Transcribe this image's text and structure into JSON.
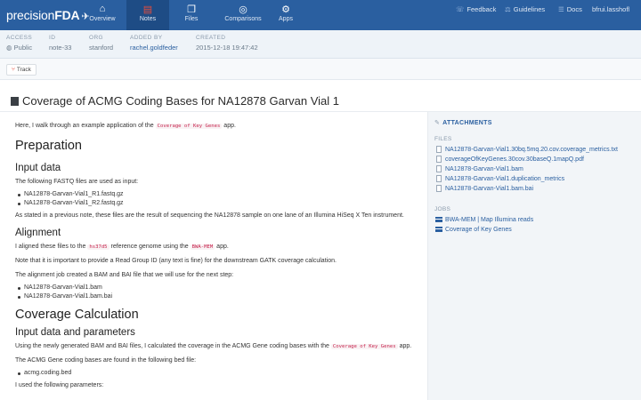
{
  "nav": {
    "brand_light": "precision",
    "brand_bold": "FDA",
    "tabs": [
      {
        "label": "Overview",
        "icon": "home-icon",
        "glyph": "⌂"
      },
      {
        "label": "Notes",
        "icon": "notes-icon",
        "glyph": "▤"
      },
      {
        "label": "Files",
        "icon": "files-icon",
        "glyph": "❐"
      },
      {
        "label": "Comparisons",
        "icon": "comparisons-icon",
        "glyph": "◎"
      },
      {
        "label": "Apps",
        "icon": "apps-icon",
        "glyph": "⚙"
      }
    ],
    "right": [
      {
        "label": "Feedback",
        "icon": "feedback-icon",
        "glyph": "☏"
      },
      {
        "label": "Guidelines",
        "icon": "guidelines-icon",
        "glyph": "⚖"
      },
      {
        "label": "Docs",
        "icon": "docs-icon",
        "glyph": "☰"
      },
      {
        "label": "bfrui.lasshofl",
        "icon": "user-icon",
        "glyph": ""
      }
    ]
  },
  "meta": {
    "access": {
      "label": "ACCESS",
      "value": "Public"
    },
    "id": {
      "label": "ID",
      "value": "note-33"
    },
    "org": {
      "label": "ORG",
      "value": "stanford"
    },
    "added_by": {
      "label": "ADDED BY",
      "value": "rachel.goldfeder"
    },
    "created": {
      "label": "CREATED",
      "value": "2015-12-18 19:47:42"
    }
  },
  "track_label": "Track",
  "title": "Coverage of ACMG Coding Bases for NA12878 Garvan Vial 1",
  "body": {
    "intro_pre": "Here, I walk through an example application of the",
    "intro_code": "Coverage of Key Genes",
    "intro_post": "app.",
    "h_preparation": "Preparation",
    "h_input_data": "Input data",
    "fastq_intro": "The following FASTQ files are used as input:",
    "fastq_files": [
      "NA12878-Garvan-Vial1_R1.fastq.gz",
      "NA12878-Garvan-Vial1_R2.fastq.gz"
    ],
    "fastq_note": "As stated in a previous note, these files are the result of sequencing the NA12878 sample on one lane of an Illumina HiSeq X Ten instrument.",
    "h_alignment": "Alignment",
    "align_pre": "I aligned these files to the",
    "align_code1": "hs37d5",
    "align_mid": "reference genome using the",
    "align_code2": "BWA-MEM",
    "align_post": "app.",
    "readgroup_note": "Note that it is important to provide a Read Group ID (any text is fine) for the downstream GATK coverage calculation.",
    "align_output_intro": "The alignment job created a BAM and BAI file that we will use for the next step:",
    "align_outputs": [
      "NA12878-Garvan-Vial1.bam",
      "NA12878-Garvan-Vial1.bam.bai"
    ],
    "h_coverage": "Coverage Calculation",
    "h_input_params": "Input data and parameters",
    "cov_pre": "Using the newly generated BAM and BAI files, I calculated the coverage in the ACMG Gene coding bases with the",
    "cov_code": "Coverage of Key Genes",
    "cov_post": "app.",
    "bed_intro": "The ACMG Gene coding bases are found in the following bed file:",
    "bed_files": [
      "acmg.coding.bed"
    ],
    "params_intro": "I used the following parameters:"
  },
  "attachments": {
    "heading": "ATTACHMENTS",
    "files_label": "FILES",
    "files": [
      "NA12878-Garvan-Vial1.30bq.5mq.20.cov.coverage_metrics.txt",
      "coverageOfKeyGenes.30cov.30baseQ.1mapQ.pdf",
      "NA12878-Garvan-Vial1.bam",
      "NA12878-Garvan-Vial1.duplication_metrics",
      "NA12878-Garvan-Vial1.bam.bai"
    ],
    "jobs_label": "JOBS",
    "jobs": [
      "BWA-MEM | Map Illumina reads",
      "Coverage of Key Genes"
    ]
  }
}
